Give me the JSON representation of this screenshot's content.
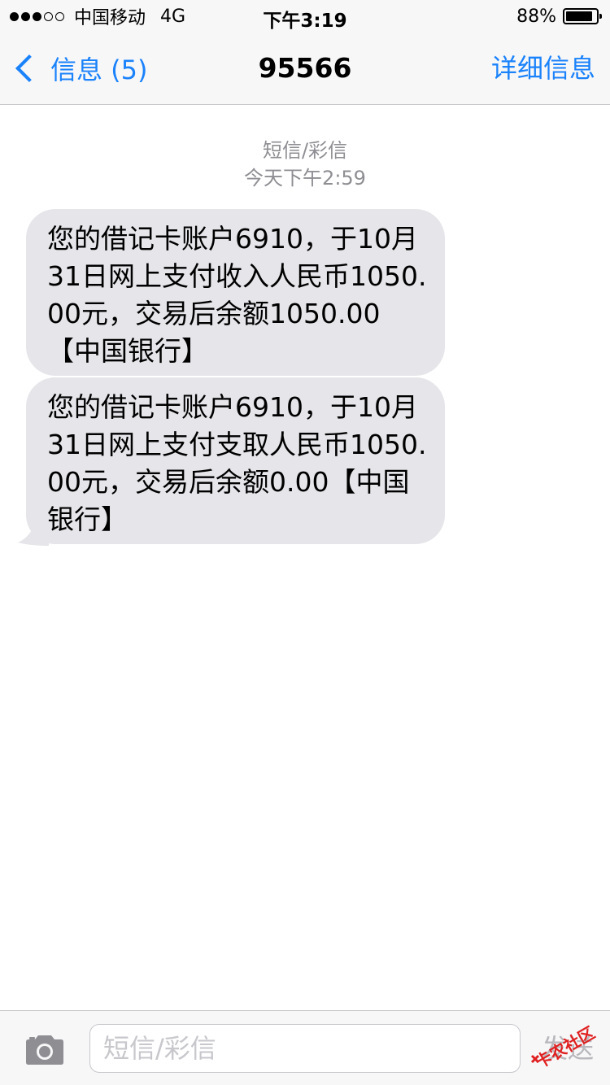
{
  "status_bar": {
    "signal_filled": 3,
    "signal_total": 5,
    "carrier": "中国移动",
    "network": "4G",
    "time": "下午3:19",
    "battery_percent_label": "88%",
    "battery_level": 0.88
  },
  "nav": {
    "back_label": "信息 (5)",
    "title": "95566",
    "details_label": "详细信息",
    "accent_color": "#1a82fb"
  },
  "thread": {
    "type_label": "短信/彩信",
    "timestamp": "今天下午2:59",
    "messages": [
      {
        "text": "您的借记卡账户6910，于10月31日网上支付收入人民币1050.00元，交易后余额1050.00【中国银行】"
      },
      {
        "text": "您的借记卡账户6910，于10月31日网上支付支取人民币1050.00元，交易后余额0.00【中国银行】"
      }
    ]
  },
  "input_bar": {
    "camera_icon": "camera-icon",
    "placeholder": "短信/彩信",
    "send_label": "发送"
  },
  "watermark": {
    "text": "卡农社区"
  }
}
